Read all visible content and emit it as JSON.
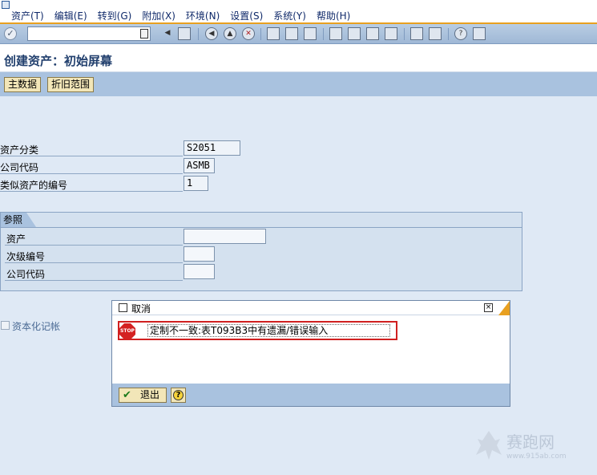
{
  "menu": {
    "items": [
      "资产(T)",
      "编辑(E)",
      "转到(G)",
      "附加(X)",
      "环境(N)",
      "设置(S)",
      "系统(Y)",
      "帮助(H)"
    ]
  },
  "toolbar": {
    "command_field_value": "",
    "icons": [
      "enter-icon",
      "history-icon",
      "back-icon",
      "save-icon",
      "back-nav-icon",
      "exit-icon",
      "cancel-icon",
      "print-icon",
      "find-icon",
      "find-next-icon",
      "first-page-icon",
      "prev-page-icon",
      "next-page-icon",
      "last-page-icon",
      "new-session-icon",
      "shortcut-icon",
      "help-icon",
      "layout-icon"
    ]
  },
  "title": "创建资产：初始屏幕",
  "app_toolbar": {
    "master_data_label": "主数据",
    "depreciation_area_label": "折旧范围"
  },
  "form": {
    "asset_class_label": "资产分类",
    "asset_class_value": "S2051",
    "company_code_label": "公司代码",
    "company_code_value": "ASMB",
    "similar_assets_label": "类似资产的编号",
    "similar_assets_value": "1"
  },
  "reference": {
    "title": "参照",
    "asset_label": "资产",
    "asset_value": "",
    "subnumber_label": "次级编号",
    "subnumber_value": "",
    "company_code_label": "公司代码",
    "company_code_value": ""
  },
  "post_capitalization": {
    "label": "资本化记帐",
    "checked": false
  },
  "dialog": {
    "title": "取消",
    "close_symbol": "×",
    "stop_text": "STOP",
    "message": "定制不一致:表T093B3中有遗漏/错误输入",
    "exit_label": "退出",
    "help_symbol": "?"
  },
  "watermark": {
    "text": "赛跑网",
    "url": "www.915ab.com"
  },
  "colors": {
    "menu_accent": "#e8a020",
    "main_background": "#dfe9f5",
    "button_background": "#f2e6b8",
    "error_frame": "#d02020",
    "stop_red": "#d42222"
  }
}
